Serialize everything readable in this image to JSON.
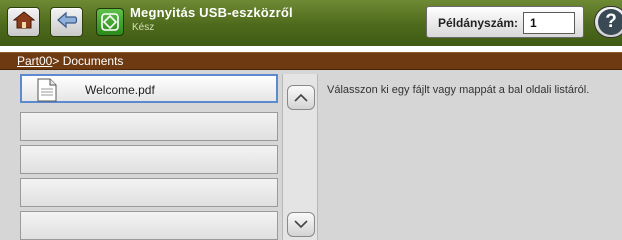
{
  "header": {
    "title": "Megnyitás USB-eszközről",
    "status": "Kész",
    "copies_label": "Példányszám:",
    "copies_value": "1",
    "help_glyph": "?",
    "icons": [
      "home-icon",
      "back-arrow-icon",
      "usb-open-icon",
      "help-icon"
    ]
  },
  "path": {
    "root_link": "Part00",
    "separator": ">",
    "current": " Documents"
  },
  "file_list": {
    "items": [
      {
        "name": "Welcome.pdf",
        "icon": "pdf-document-icon",
        "selected": true
      },
      {
        "name": ""
      },
      {
        "name": ""
      },
      {
        "name": ""
      },
      {
        "name": ""
      }
    ]
  },
  "info": {
    "message": "Válasszon ki egy fájlt vagy mappát a bal oldali listáról."
  },
  "colors": {
    "header_green": "#4d6a1c",
    "path_brown": "#6e3a12",
    "selection_blue": "#5b8ad0"
  }
}
